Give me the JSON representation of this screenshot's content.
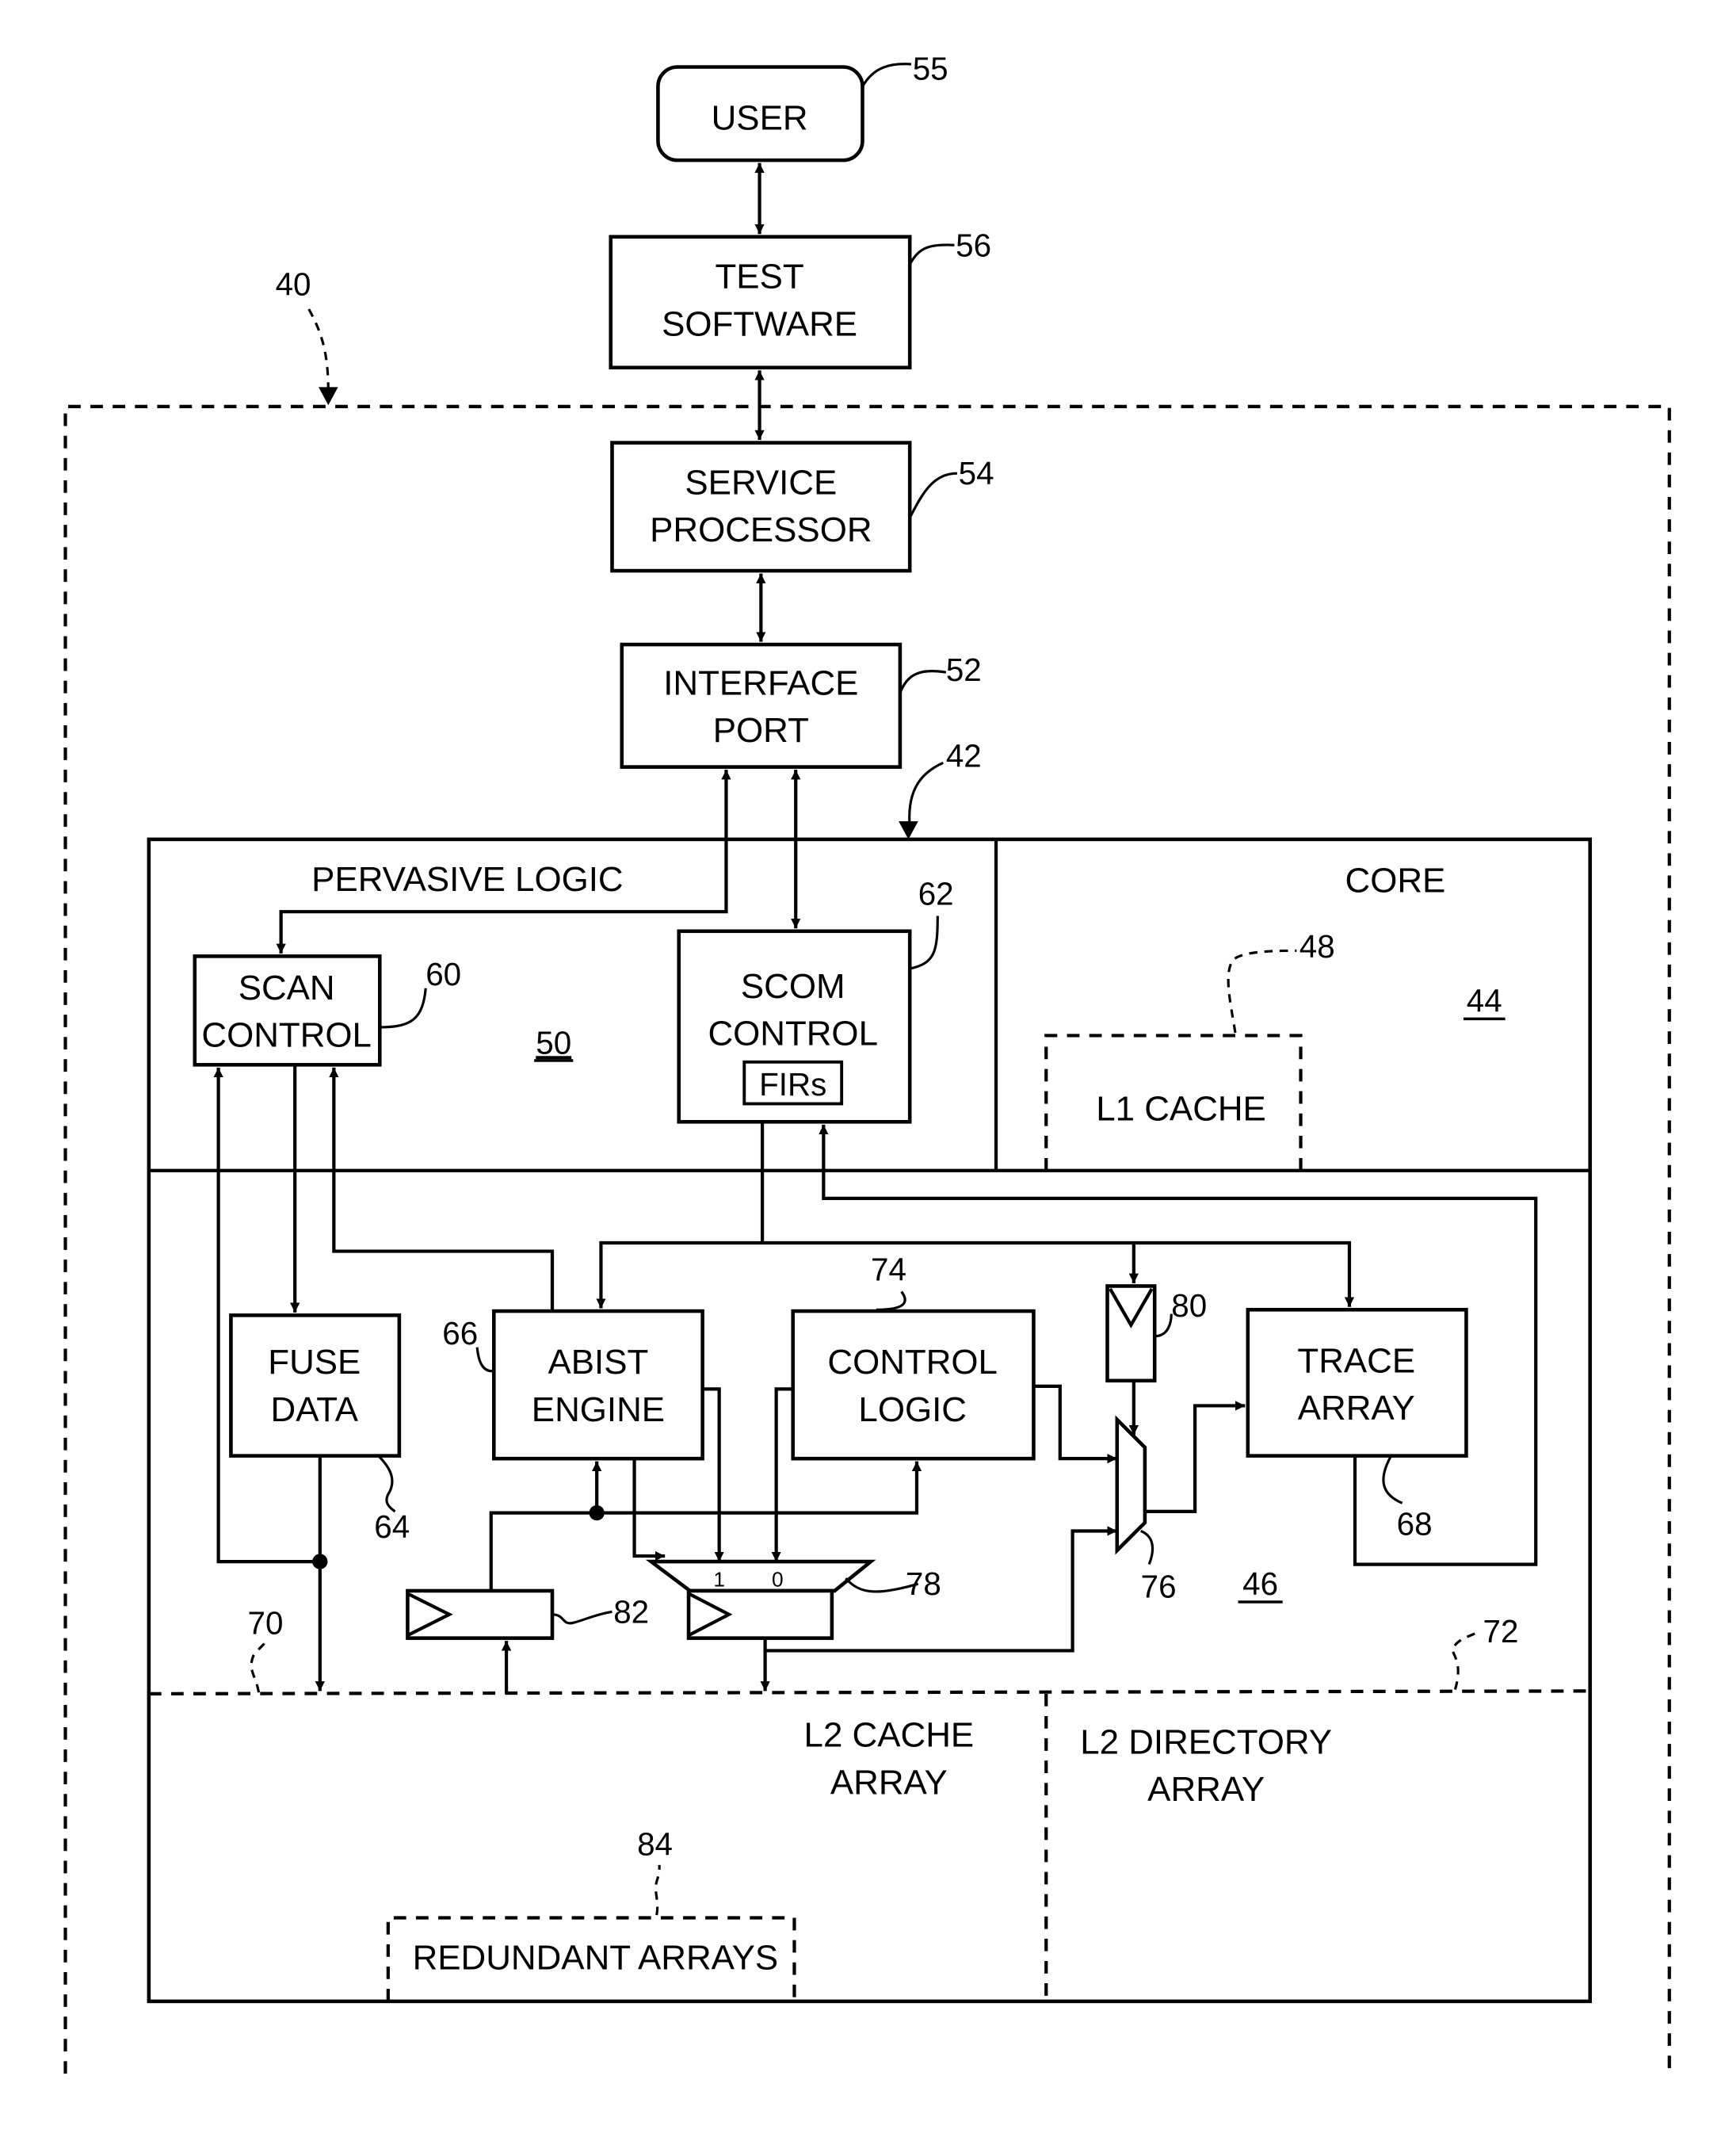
{
  "figure": {
    "blocks": {
      "user": {
        "label": "USER",
        "ref": "55"
      },
      "test_software": {
        "line1": "TEST",
        "line2": "SOFTWARE",
        "ref": "56"
      },
      "service_processor": {
        "line1": "SERVICE",
        "line2": "PROCESSOR",
        "ref": "54"
      },
      "interface_port": {
        "line1": "INTERFACE",
        "line2": "PORT",
        "ref": "52"
      },
      "pervasive_logic": {
        "label": "PERVASIVE LOGIC",
        "ref": "50"
      },
      "core": {
        "label": "CORE",
        "ref": "44"
      },
      "l1_cache": {
        "label": "L1 CACHE",
        "ref": "48"
      },
      "scan_control": {
        "line1": "SCAN",
        "line2": "CONTROL",
        "ref": "60"
      },
      "scom_control": {
        "line1": "SCOM",
        "line2": "CONTROL",
        "inner": "FIRs",
        "ref": "62"
      },
      "fuse_data": {
        "line1": "FUSE",
        "line2": "DATA",
        "ref": "64"
      },
      "abist_engine": {
        "line1": "ABIST",
        "line2": "ENGINE",
        "ref": "66"
      },
      "control_logic": {
        "line1": "CONTROL",
        "line2": "LOGIC",
        "ref": "74"
      },
      "trace_array": {
        "line1": "TRACE",
        "line2": "ARRAY",
        "ref": "68"
      },
      "latch_80": {
        "ref": "80"
      },
      "mux_76": {
        "ref": "76"
      },
      "mux_latch_78": {
        "ref": "78",
        "input_1": "1",
        "input_0": "0"
      },
      "latch_82": {
        "ref": "82"
      },
      "l2_cache_array": {
        "line1": "L2 CACHE",
        "line2": "ARRAY",
        "ref": "70"
      },
      "l2_directory_array": {
        "line1": "L2 DIRECTORY",
        "line2": "ARRAY",
        "ref": "72"
      },
      "redundant_arrays": {
        "label": "REDUNDANT ARRAYS",
        "ref": "84"
      },
      "l2_region": {
        "ref": "46"
      }
    },
    "system_ref": "40",
    "chip_ref": "42"
  }
}
